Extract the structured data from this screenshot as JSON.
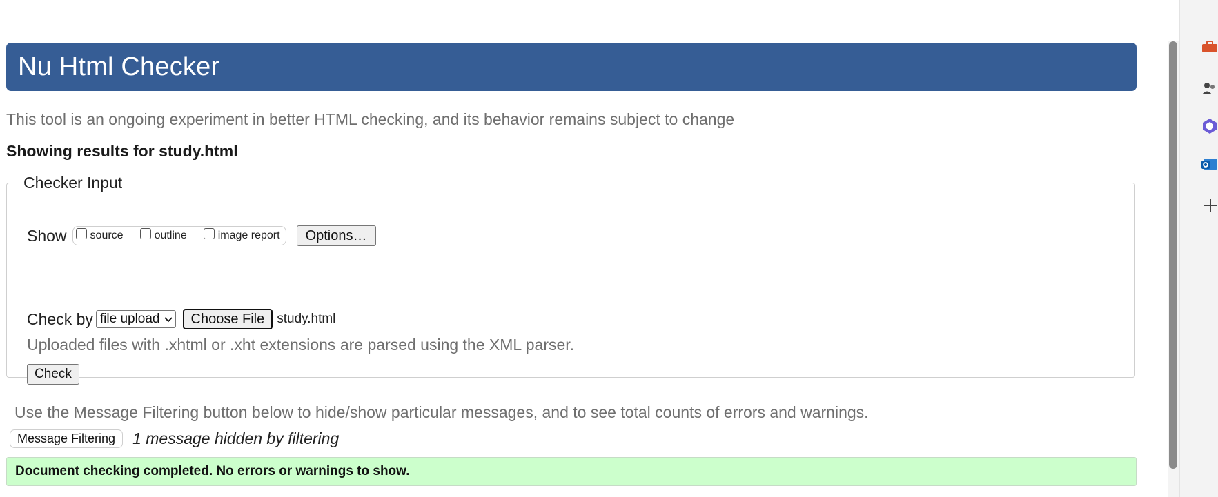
{
  "header": {
    "title": "Nu Html Checker"
  },
  "intro": "This tool is an ongoing experiment in better HTML checking, and its behavior remains subject to change",
  "results_for": "Showing results for study.html",
  "checker_input": {
    "legend": "Checker Input",
    "show_label": "Show",
    "show_options": [
      {
        "label": "source",
        "checked": false
      },
      {
        "label": "outline",
        "checked": false
      },
      {
        "label": "image report",
        "checked": false
      }
    ],
    "options_button": "Options…",
    "check_by_label": "Check by",
    "check_by_value": "file upload",
    "choose_file_button": "Choose File",
    "file_name": "study.html",
    "upload_note": "Uploaded files with .xhtml or .xht extensions are parsed using the XML parser.",
    "check_button": "Check"
  },
  "filtering": {
    "note": "Use the Message Filtering button below to hide/show particular messages, and to see total counts of errors and warnings.",
    "button": "Message Filtering",
    "hidden_count": "1 message hidden by filtering"
  },
  "status_message": "Document checking completed. No errors or warnings to show.",
  "colors": {
    "header_bg": "#365d95",
    "success_bg": "#ccffcc"
  },
  "sidebar": {
    "icons": [
      "toolbox-icon",
      "people-icon",
      "copilot-icon",
      "outlook-icon",
      "add-icon"
    ]
  }
}
